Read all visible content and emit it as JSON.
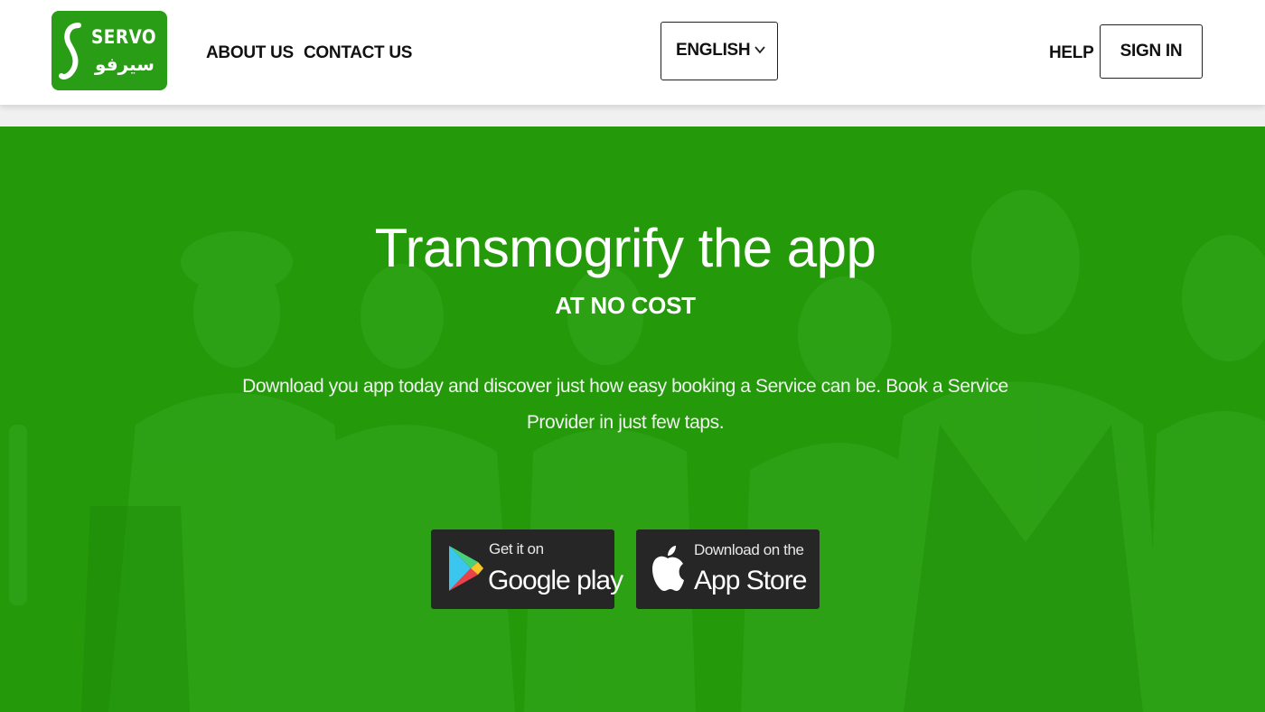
{
  "brand": {
    "name_en": "SERVO",
    "name_ar": "سيرفو",
    "color": "#2a9d16"
  },
  "nav": {
    "about": "ABOUT US",
    "contact": "CONTACT US",
    "language": "ENGLISH",
    "help": "HELP",
    "signin": "SIGN IN"
  },
  "hero": {
    "title": "Transmogrify the app",
    "subtitle": "AT NO COST",
    "description": "Download you app today and discover just how easy booking a Service can be. Book a Service Provider in just few taps.",
    "bg_color": "#24990a"
  },
  "stores": {
    "google": {
      "small": "Get it on",
      "big": "Google play",
      "icon": "google-play-icon"
    },
    "apple": {
      "small": "Download on the",
      "big": "App Store",
      "icon": "apple-icon"
    }
  }
}
